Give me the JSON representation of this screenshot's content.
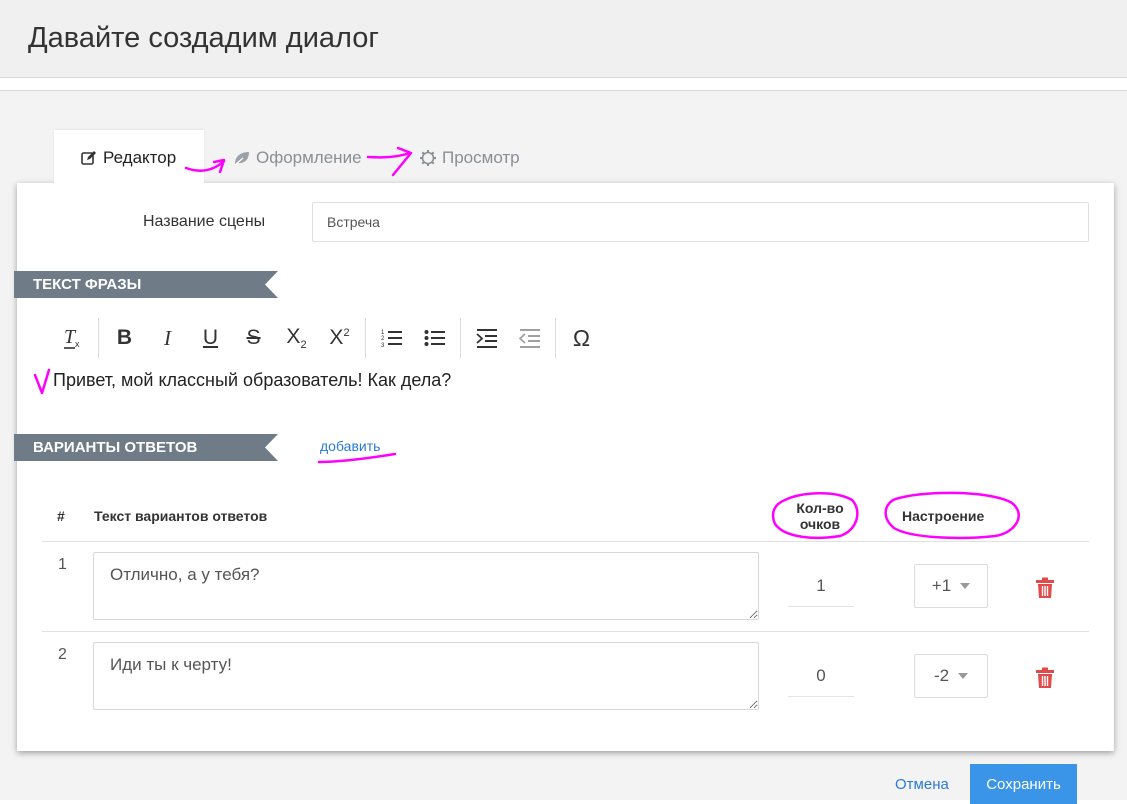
{
  "header": {
    "title": "Давайте создадим диалог"
  },
  "tabs": [
    {
      "label": "Редактор",
      "icon": "edit-icon",
      "active": true
    },
    {
      "label": "Оформление",
      "icon": "leaf-icon",
      "active": false
    },
    {
      "label": "Просмотр",
      "icon": "gear-icon",
      "active": false
    }
  ],
  "scene": {
    "label": "Название сцены",
    "value": "Встреча"
  },
  "phrase_section": {
    "title": "ТЕКСТ ФРАЗЫ",
    "text": "Привет, мой классный образователь! Как дела?"
  },
  "toolbar": {
    "buttons": [
      "clear-format-icon",
      "bold-icon",
      "italic-icon",
      "underline-icon",
      "strikethrough-icon",
      "subscript-icon",
      "superscript-icon",
      "ordered-list-icon",
      "unordered-list-icon",
      "indent-icon",
      "outdent-icon",
      "special-char-icon"
    ]
  },
  "answers_section": {
    "title": "ВАРИАНТЫ ОТВЕТОВ",
    "add_label": "добавить",
    "columns": {
      "num": "#",
      "text": "Текст вариантов ответов",
      "points_line1": "Кол-во",
      "points_line2": "очков",
      "mood": "Настроение"
    },
    "rows": [
      {
        "num": "1",
        "text": "Отлично, а у тебя?",
        "points": "1",
        "mood": "+1"
      },
      {
        "num": "2",
        "text": "Иди ты к черту!",
        "points": "0",
        "mood": "-2"
      }
    ]
  },
  "footer": {
    "cancel_label": "Отмена",
    "save_label": "Сохранить"
  },
  "colors": {
    "ribbon": "#6f7b86",
    "primary": "#3a95e8",
    "link": "#2a7ad6",
    "delete": "#e04a4a",
    "annotation": "#ff00ff"
  }
}
